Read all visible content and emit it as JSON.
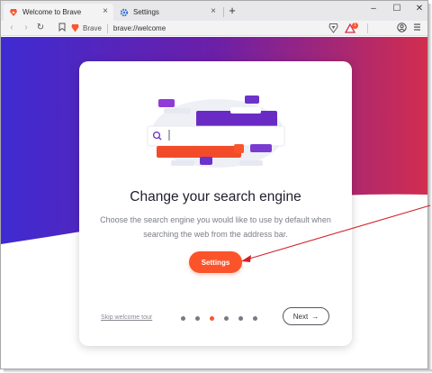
{
  "tabs": [
    {
      "title": "Welcome to Brave",
      "icon": "brave-lion-icon",
      "close": "×"
    },
    {
      "title": "Settings",
      "icon": "gear-icon",
      "close": "×"
    }
  ],
  "new_tab_label": "+",
  "window_controls": {
    "minimize": "–",
    "maximize": "☐",
    "close": "✕"
  },
  "toolbar": {
    "back": "‹",
    "forward": "›",
    "reload": "↻",
    "site_label": "Brave",
    "url": "brave://welcome",
    "rewards_badge": "1"
  },
  "colors": {
    "accent": "#fb542b",
    "gradient_start": "#3f2bd1",
    "gradient_mid": "#6b1fa8",
    "gradient_end": "#d22d4f",
    "annotation_arrow": "#d21f26"
  },
  "welcome": {
    "title": "Change your search engine",
    "description": "Choose the search engine you would like to use by default when searching the web from the address bar.",
    "settings_button": "Settings",
    "skip_link": "Skip welcome tour",
    "next_button": "Next",
    "next_arrow": "→",
    "step_count": 6,
    "active_step": 3
  }
}
